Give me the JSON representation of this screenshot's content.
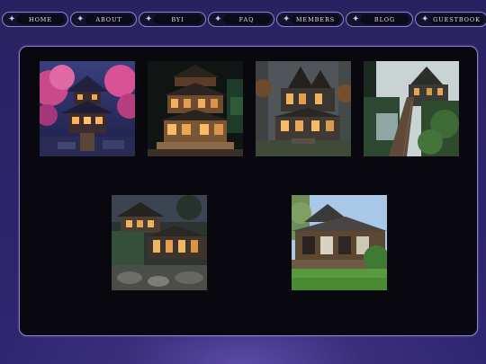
{
  "nav": {
    "items": [
      {
        "label": "HOME",
        "icon": "sparkle-icon"
      },
      {
        "label": "ABOUT",
        "icon": "sparkle-icon"
      },
      {
        "label": "BYI",
        "icon": "sparkle-icon"
      },
      {
        "label": "FAQ",
        "icon": "sparkle-icon"
      },
      {
        "label": "MEMBERS",
        "icon": "sparkle-icon"
      },
      {
        "label": "BLOG",
        "icon": "sparkle-icon"
      },
      {
        "label": "GUESTBOOK",
        "icon": "sparkle-icon"
      }
    ],
    "star_glyph": "✦"
  },
  "gallery": {
    "images": [
      {
        "subject": "pagoda-house-cherry-blossom-night"
      },
      {
        "subject": "japanese-house-miniature-model"
      },
      {
        "subject": "victorian-house-in-forest"
      },
      {
        "subject": "house-with-wooden-boardwalk"
      },
      {
        "subject": "japanese-house-garden-evening"
      },
      {
        "subject": "japanese-house-daylight"
      }
    ]
  },
  "colors": {
    "accent_border": "#8a80d2",
    "panel_bg": "#08080e",
    "background_top": "#2a2260",
    "glow": "#5b4aa8"
  }
}
